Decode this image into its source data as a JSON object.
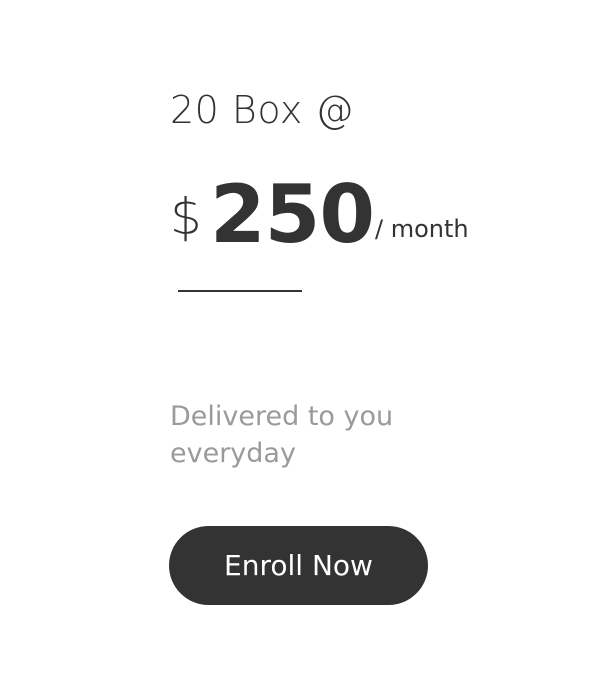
{
  "plan": {
    "title": "20 Box @",
    "currency": "$",
    "amount": "250",
    "period": "/ month",
    "description_line1": "Delivered to you",
    "description_line2": "everyday",
    "cta_label": "Enroll Now"
  },
  "colors": {
    "text_primary": "#333333",
    "text_muted": "#9a9a9a",
    "button_bg": "#333333",
    "button_text": "#ffffff",
    "background": "#ffffff"
  }
}
